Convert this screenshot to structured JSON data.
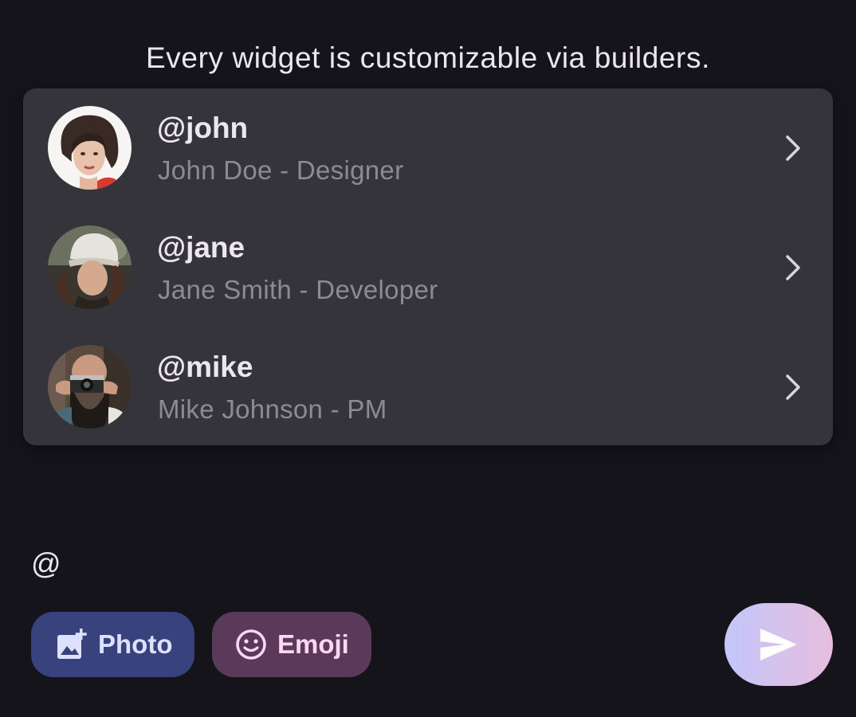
{
  "caption": "Every widget is customizable via builders.",
  "mentions": [
    {
      "handle": "@john",
      "subtitle": "John Doe - Designer",
      "avatar_icon": "avatar-john-photo",
      "chevron_icon": "chevron-right-icon"
    },
    {
      "handle": "@jane",
      "subtitle": "Jane Smith - Developer",
      "avatar_icon": "avatar-jane-photo",
      "chevron_icon": "chevron-right-icon"
    },
    {
      "handle": "@mike",
      "subtitle": "Mike Johnson - PM",
      "avatar_icon": "avatar-mike-photo",
      "chevron_icon": "chevron-right-icon"
    }
  ],
  "composer": {
    "value": "@",
    "photo_label": "Photo",
    "photo_icon": "add-photo-icon",
    "emoji_label": "Emoji",
    "emoji_icon": "smiley-icon",
    "send_icon": "send-icon"
  },
  "colors": {
    "background": "#15141a",
    "panel": "#36343b",
    "photo_pill": "#38427d",
    "emoji_pill": "#5a3a58",
    "send_gradient_start": "#c3c6fb",
    "send_gradient_end": "#e7bede"
  }
}
